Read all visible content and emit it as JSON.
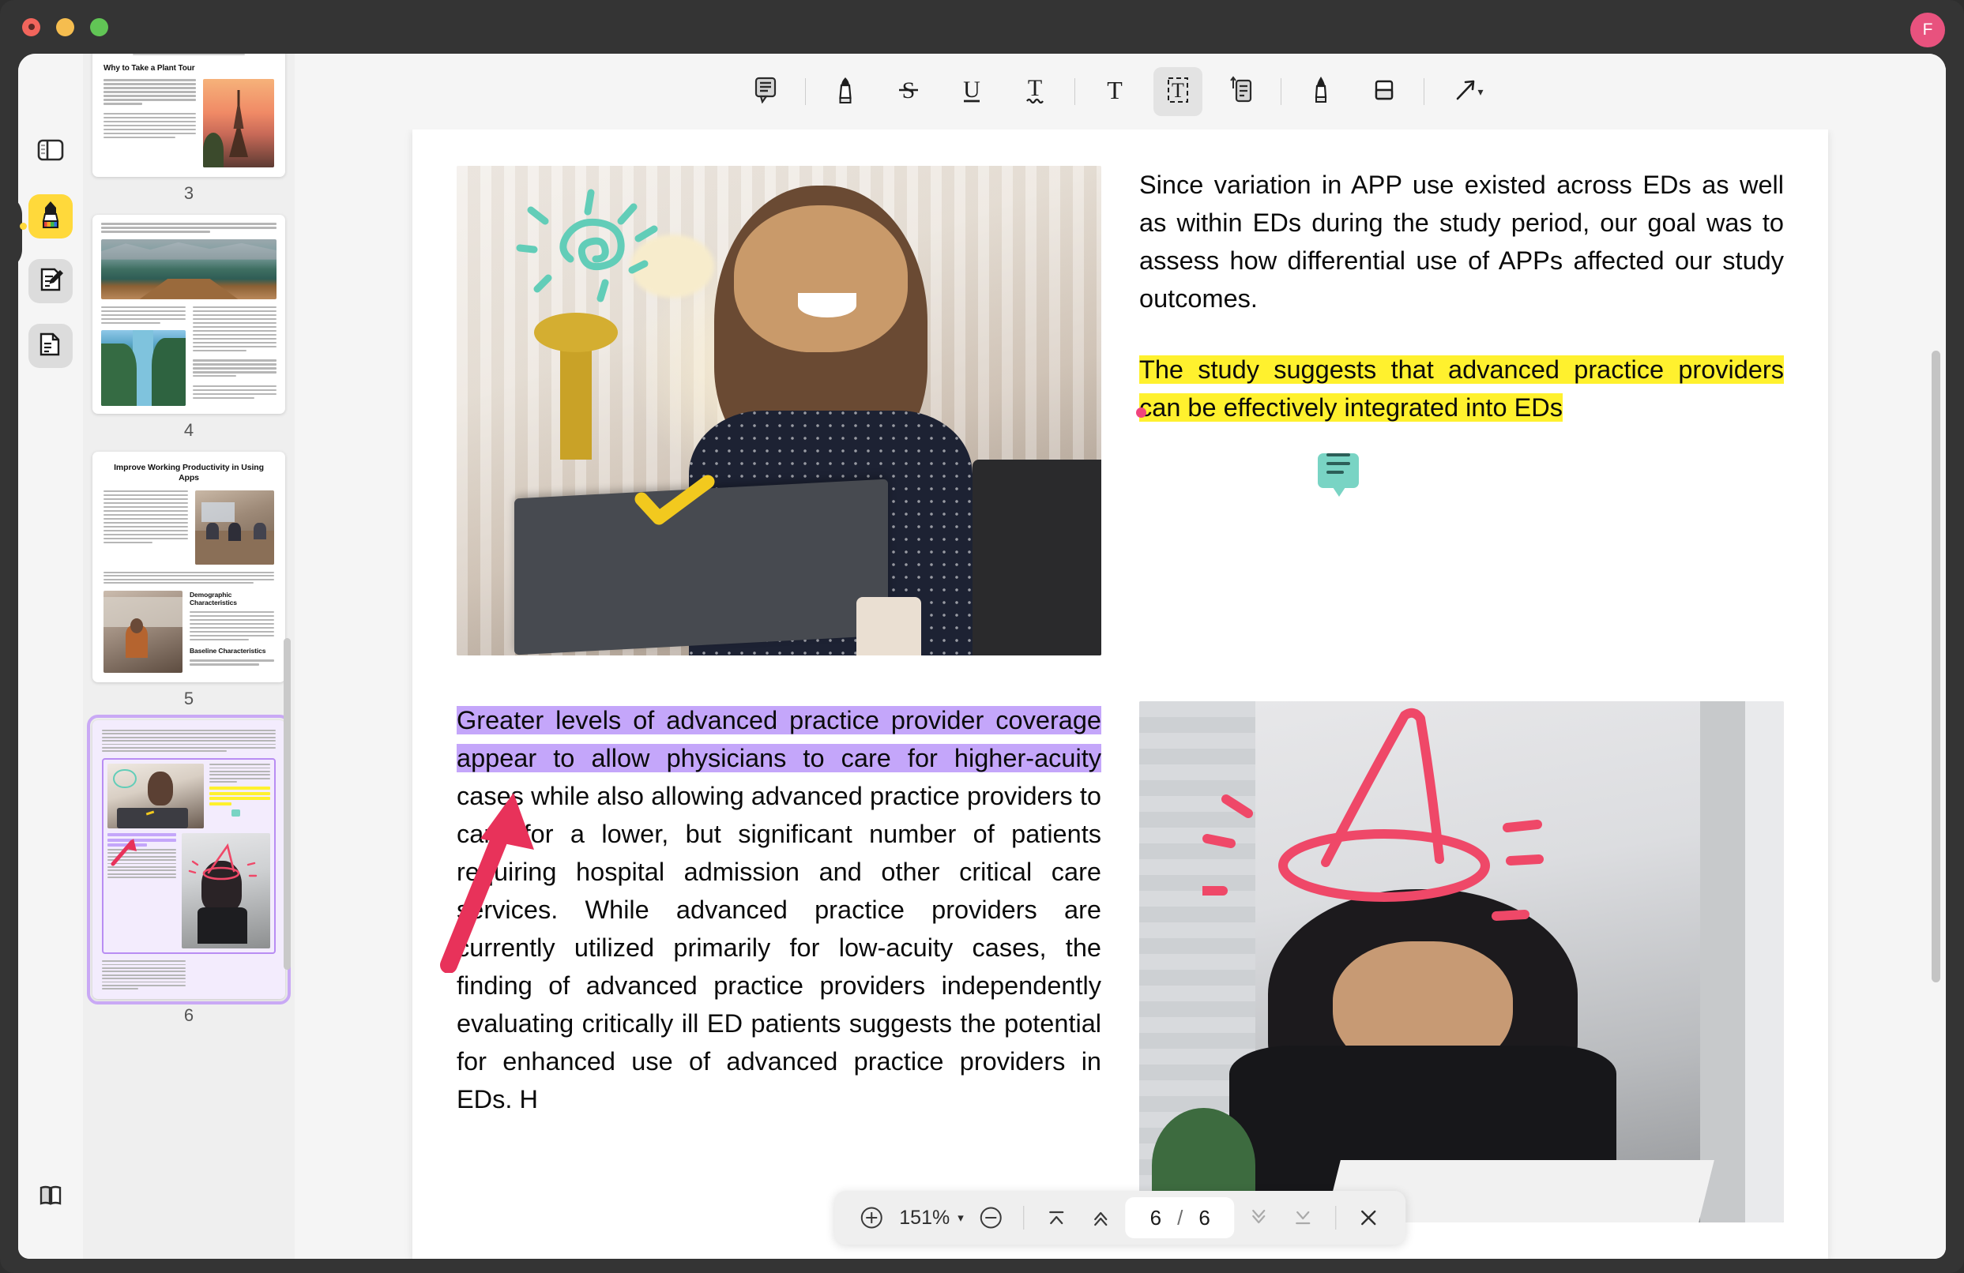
{
  "window": {
    "traffic_lights": [
      "close",
      "minimize",
      "maximize"
    ],
    "avatar_initial": "F"
  },
  "tool_rail": {
    "items": [
      {
        "name": "toggle-sidebar",
        "icon": "panel-toggle-icon",
        "state": "plain"
      },
      {
        "name": "highlighter-tool",
        "icon": "highlighter-icon",
        "state": "active"
      },
      {
        "name": "annotate-tool",
        "icon": "edit-document-icon",
        "state": "chip"
      },
      {
        "name": "page-organize-tool",
        "icon": "document-pages-icon",
        "state": "chip"
      }
    ],
    "bottom": {
      "name": "reading-view",
      "icon": "book-open-icon"
    }
  },
  "toolbar": {
    "items": [
      {
        "name": "sticky-note-button",
        "icon": "note-comment-icon",
        "active": false
      },
      {
        "name": "separator-1",
        "icon": "separator",
        "active": false
      },
      {
        "name": "highlight-button",
        "icon": "highlighter-pen-icon",
        "active": false
      },
      {
        "name": "strikethrough-button",
        "icon": "strikethrough-s-icon",
        "active": false
      },
      {
        "name": "underline-button",
        "icon": "underline-u-icon",
        "active": false
      },
      {
        "name": "squiggly-button",
        "icon": "squiggly-underline-icon",
        "active": false
      },
      {
        "name": "separator-2",
        "icon": "separator",
        "active": false
      },
      {
        "name": "text-button",
        "icon": "text-t-icon",
        "active": false
      },
      {
        "name": "text-box-button",
        "icon": "text-box-icon",
        "active": true
      },
      {
        "name": "note-list-button",
        "icon": "note-list-icon",
        "active": false
      },
      {
        "name": "separator-3",
        "icon": "separator",
        "active": false
      },
      {
        "name": "pen-button",
        "icon": "pen-icon",
        "active": false
      },
      {
        "name": "eraser-button",
        "icon": "eraser-icon",
        "active": false
      },
      {
        "name": "separator-4",
        "icon": "separator",
        "active": false
      },
      {
        "name": "shapes-button",
        "icon": "arrow-line-icon",
        "active": false,
        "has_caret": true
      }
    ]
  },
  "thumbnails": {
    "pages": [
      {
        "number": "3",
        "title": "Why to Take a Plant Tour",
        "selected": false,
        "layout": "title-text-photo"
      },
      {
        "number": "4",
        "title": "",
        "selected": false,
        "layout": "photo-two-column"
      },
      {
        "number": "5",
        "title": "Improve Working Productivity in Using Apps",
        "subheads": [
          "Demographic Characteristics",
          "Baseline Characteristics"
        ],
        "selected": false,
        "layout": "title-text-photo-sections"
      },
      {
        "number": "6",
        "title": "",
        "selected": true,
        "layout": "annotated-current-page"
      }
    ]
  },
  "document": {
    "paragraphs": {
      "intro": "Since variation in APP use existed across EDs as well as within EDs during the study period, our goal was to assess how differential use of APPs affected our study outcomes.",
      "highlighted_yellow": "The study suggests that advanced practice providers can be effectively integrated into EDs",
      "body_purple_part": "Greater levels of advanced practice provider coverage appear to allow physicians to care for higher-acuity",
      "body_rest": " cases while also allowing advanced practice providers to care for a lower, but significant number of patients requiring hospital admission and other critical care services. While advanced practice providers are currently utilized primarily for low-acuity cases, the finding of advanced practice providers independently evaluating critically ill ED patients suggests the potential for enhanced use of advanced practice providers in EDs. H"
    },
    "annotations": [
      {
        "name": "sun-doodle",
        "color": "#62cdb8",
        "tool": "pen"
      },
      {
        "name": "check-doodle",
        "color": "#f2c91e",
        "tool": "pen"
      },
      {
        "name": "witch-hat-doodle",
        "color": "#ef4868",
        "tool": "pen"
      },
      {
        "name": "arrow-doodle",
        "color": "#e8325a",
        "tool": "pen"
      },
      {
        "name": "comment-pin",
        "color": "#79d4c4",
        "tool": "sticky-note"
      },
      {
        "name": "highlight-marker-dot",
        "color": "#f0447c",
        "tool": "marker"
      }
    ],
    "colors": {
      "yellow_highlight": "#fff12e",
      "purple_highlight": "#c4a6fa",
      "accent_pink": "#e8527e"
    }
  },
  "pager": {
    "zoom_in_label": "+",
    "zoom_value": "151%",
    "zoom_out_label": "−",
    "first_page_label": "first-page",
    "prev_page_label": "previous-page",
    "current_page": "6",
    "separator": "/",
    "total_pages": "6",
    "next_page_label": "next-page",
    "last_page_label": "last-page",
    "close_label": "×"
  }
}
